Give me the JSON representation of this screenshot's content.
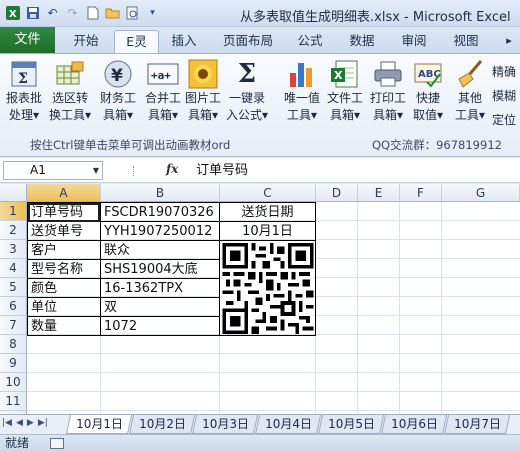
{
  "window": {
    "title": "从多表取值生成明细表.xlsx - Microsoft Excel"
  },
  "quick_access": [
    "excel-logo-icon",
    "save-icon",
    "undo-icon",
    "redo-icon",
    "new-file-icon",
    "open-folder-icon",
    "print-preview-icon",
    "customize-dropdown-icon"
  ],
  "tabs": [
    {
      "label": "文件"
    },
    {
      "label": "开始"
    },
    {
      "label": "E灵"
    },
    {
      "label": "插入"
    },
    {
      "label": "页面布局"
    },
    {
      "label": "公式"
    },
    {
      "label": "数据"
    },
    {
      "label": "审阅"
    },
    {
      "label": "视图"
    }
  ],
  "ribbon": {
    "buttons": [
      {
        "l1": "报表批",
        "l2": "处理▾",
        "icon": "sigma-sheet-icon"
      },
      {
        "l1": "选区转",
        "l2": "换工具▾",
        "icon": "table-convert-icon"
      },
      {
        "l1": "财务工",
        "l2": "具箱▾",
        "icon": "yen-icon"
      },
      {
        "l1": "合并工",
        "l2": "具箱▾",
        "icon": "merge-icon"
      },
      {
        "l1": "图片工",
        "l2": "具箱▾",
        "icon": "sunflower-icon"
      },
      {
        "l1": "一键录",
        "l2": "入公式▾",
        "icon": "sigma-icon"
      },
      {
        "l1": "唯一值",
        "l2": "工具▾",
        "icon": "bar-chart-icon"
      },
      {
        "l1": "文件工",
        "l2": "具箱▾",
        "icon": "excel-file-icon"
      },
      {
        "l1": "打印工",
        "l2": "具箱▾",
        "icon": "printer-icon"
      },
      {
        "l1": "快捷",
        "l2": "取值▾",
        "icon": "abc-check-icon"
      },
      {
        "l1": "其他",
        "l2": "工具▾",
        "icon": "broom-icon"
      },
      {
        "l1": "精确",
        "l2": "模糊",
        "l3": "定位",
        "icon": ""
      }
    ],
    "hint": "按住Ctrl键单击菜单可调出动画教材ord",
    "qq": "QQ交流群：967819912"
  },
  "formula_bar": {
    "name_box": "A1",
    "fx": "fx",
    "content": "订单号码"
  },
  "columns": [
    "A",
    "B",
    "C",
    "D",
    "E",
    "F",
    "G"
  ],
  "rows": [
    "1",
    "2",
    "3",
    "4",
    "5",
    "6",
    "7",
    "8",
    "9",
    "10",
    "11",
    "12"
  ],
  "cells": {
    "A1": "订单号码",
    "B1": "FSCDR19070326",
    "C1": "送货日期",
    "A2": "送货单号",
    "B2": "YYH1907250012",
    "C2": "10月1日",
    "A3": "客户",
    "B3": "联众",
    "A4": "型号名称",
    "B4": "SHS19004大底",
    "A5": "颜色",
    "B5": "16-1362TPX",
    "A6": "单位",
    "B6": "双",
    "A7": "数量",
    "B7": "1072"
  },
  "qr_code": {
    "icon": "qr-code-icon"
  },
  "sheet_tabs": [
    "10月1日",
    "10月2日",
    "10月3日",
    "10月4日",
    "10月5日",
    "10月6日",
    "10月7日"
  ],
  "active_sheet": "10月1日",
  "status": {
    "text": "就绪"
  }
}
